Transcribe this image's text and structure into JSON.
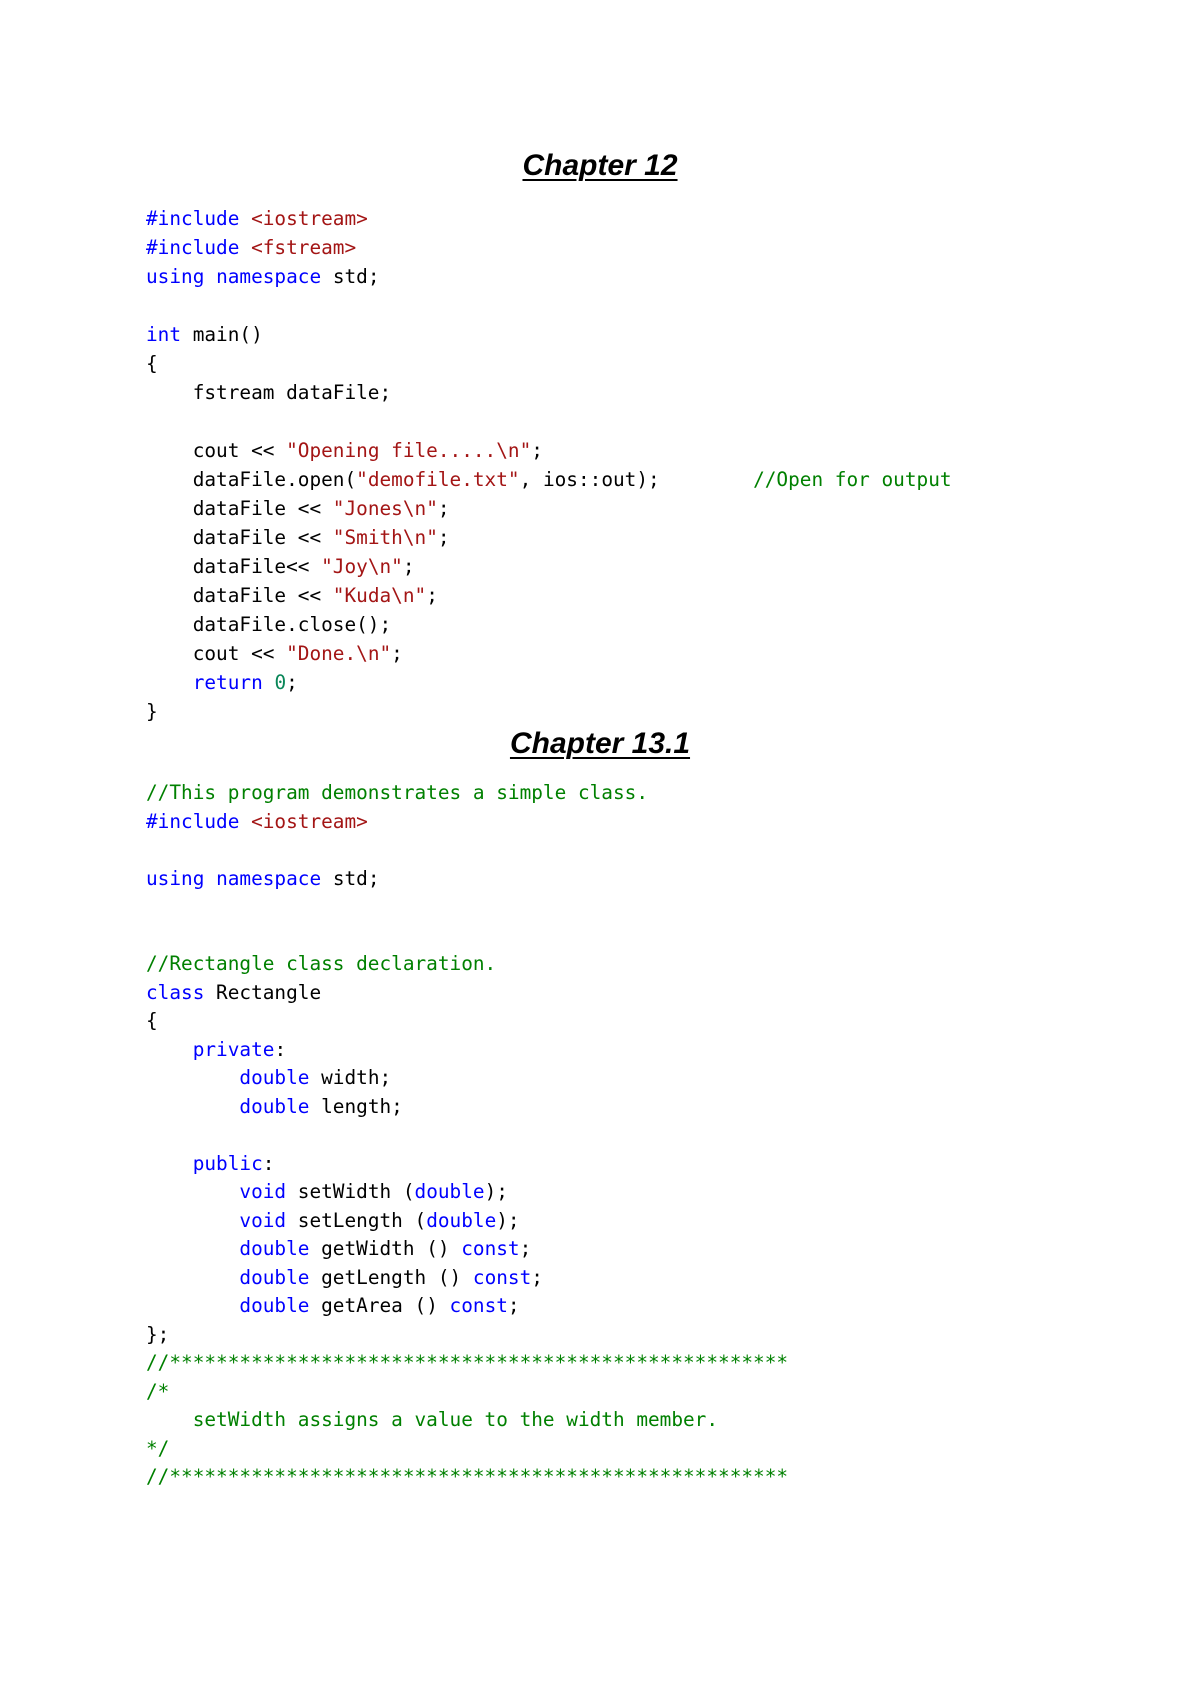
{
  "sections": [
    {
      "heading": "Chapter 12",
      "lines": [
        [
          {
            "t": "#include ",
            "c": "pp"
          },
          {
            "t": "<iostream>",
            "c": "str"
          }
        ],
        [
          {
            "t": "#include ",
            "c": "pp"
          },
          {
            "t": "<fstream>",
            "c": "str"
          }
        ],
        [
          {
            "t": "using",
            "c": "kw"
          },
          {
            "t": " "
          },
          {
            "t": "namespace",
            "c": "kw"
          },
          {
            "t": " std;"
          }
        ],
        [],
        [
          {
            "t": "int",
            "c": "kw"
          },
          {
            "t": " main()"
          }
        ],
        [
          {
            "t": "{"
          }
        ],
        [
          {
            "t": "    fstream dataFile;"
          }
        ],
        [],
        [
          {
            "t": "    cout << "
          },
          {
            "t": "\"Opening file.....\\n\"",
            "c": "str"
          },
          {
            "t": ";"
          }
        ],
        [
          {
            "t": "    dataFile.open("
          },
          {
            "t": "\"demofile.txt\"",
            "c": "str"
          },
          {
            "t": ", ios::out);        "
          },
          {
            "t": "//Open for output",
            "c": "cm"
          }
        ],
        [
          {
            "t": "    dataFile << "
          },
          {
            "t": "\"Jones\\n\"",
            "c": "str"
          },
          {
            "t": ";"
          }
        ],
        [
          {
            "t": "    dataFile << "
          },
          {
            "t": "\"Smith\\n\"",
            "c": "str"
          },
          {
            "t": ";"
          }
        ],
        [
          {
            "t": "    dataFile<< "
          },
          {
            "t": "\"Joy\\n\"",
            "c": "str"
          },
          {
            "t": ";"
          }
        ],
        [
          {
            "t": "    dataFile << "
          },
          {
            "t": "\"Kuda\\n\"",
            "c": "str"
          },
          {
            "t": ";"
          }
        ],
        [
          {
            "t": "    dataFile.close();"
          }
        ],
        [
          {
            "t": "    cout << "
          },
          {
            "t": "\"Done.\\n\"",
            "c": "str"
          },
          {
            "t": ";"
          }
        ],
        [
          {
            "t": "    "
          },
          {
            "t": "return",
            "c": "kw"
          },
          {
            "t": " "
          },
          {
            "t": "0",
            "c": "num"
          },
          {
            "t": ";"
          }
        ],
        [
          {
            "t": "}"
          }
        ]
      ]
    },
    {
      "heading": "Chapter 13.1",
      "lines": [
        [
          {
            "t": "//This program demonstrates a simple class.",
            "c": "cm"
          }
        ],
        [
          {
            "t": "#include ",
            "c": "pp"
          },
          {
            "t": "<iostream>",
            "c": "str"
          }
        ],
        [],
        [
          {
            "t": "using",
            "c": "kw"
          },
          {
            "t": " "
          },
          {
            "t": "namespace",
            "c": "kw"
          },
          {
            "t": " std;"
          }
        ],
        [],
        [],
        [
          {
            "t": "//Rectangle class declaration.",
            "c": "cm"
          }
        ],
        [
          {
            "t": "class",
            "c": "kw"
          },
          {
            "t": " Rectangle"
          }
        ],
        [
          {
            "t": "{"
          }
        ],
        [
          {
            "t": "    "
          },
          {
            "t": "private",
            "c": "kw"
          },
          {
            "t": ":"
          }
        ],
        [
          {
            "t": "        "
          },
          {
            "t": "double",
            "c": "kw"
          },
          {
            "t": " width;"
          }
        ],
        [
          {
            "t": "        "
          },
          {
            "t": "double",
            "c": "kw"
          },
          {
            "t": " length;"
          }
        ],
        [],
        [
          {
            "t": "    "
          },
          {
            "t": "public",
            "c": "kw"
          },
          {
            "t": ":"
          }
        ],
        [
          {
            "t": "        "
          },
          {
            "t": "void",
            "c": "kw"
          },
          {
            "t": " setWidth ("
          },
          {
            "t": "double",
            "c": "kw"
          },
          {
            "t": ");"
          }
        ],
        [
          {
            "t": "        "
          },
          {
            "t": "void",
            "c": "kw"
          },
          {
            "t": " setLength ("
          },
          {
            "t": "double",
            "c": "kw"
          },
          {
            "t": ");"
          }
        ],
        [
          {
            "t": "        "
          },
          {
            "t": "double",
            "c": "kw"
          },
          {
            "t": " getWidth () "
          },
          {
            "t": "const",
            "c": "kw"
          },
          {
            "t": ";"
          }
        ],
        [
          {
            "t": "        "
          },
          {
            "t": "double",
            "c": "kw"
          },
          {
            "t": " getLength () "
          },
          {
            "t": "const",
            "c": "kw"
          },
          {
            "t": ";"
          }
        ],
        [
          {
            "t": "        "
          },
          {
            "t": "double",
            "c": "kw"
          },
          {
            "t": " getArea () "
          },
          {
            "t": "const",
            "c": "kw"
          },
          {
            "t": ";"
          }
        ],
        [
          {
            "t": "};"
          }
        ],
        [
          {
            "t": "//*****************************************************",
            "c": "cm"
          }
        ],
        [
          {
            "t": "/*",
            "c": "cm"
          }
        ],
        [
          {
            "t": "    setWidth assigns a value to the width member.",
            "c": "cm"
          }
        ],
        [
          {
            "t": "*/",
            "c": "cm"
          }
        ],
        [
          {
            "t": "//*****************************************************",
            "c": "cm"
          }
        ]
      ]
    }
  ]
}
